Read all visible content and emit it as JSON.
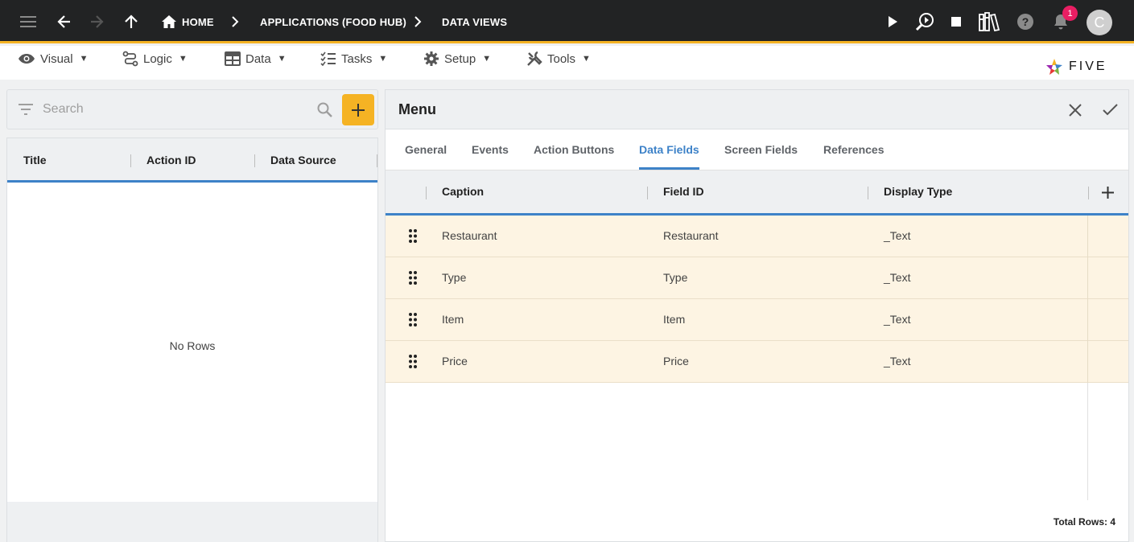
{
  "topbar": {
    "breadcrumbs": [
      "HOME",
      "APPLICATIONS (FOOD HUB)",
      "DATA VIEWS"
    ],
    "notification_count": "1",
    "avatar_initial": "C",
    "accent_color": "#f5b324"
  },
  "menubar": {
    "items": [
      "Visual",
      "Logic",
      "Data",
      "Tasks",
      "Setup",
      "Tools"
    ],
    "logo_text": "FIVE"
  },
  "left": {
    "search_placeholder": "Search",
    "columns": [
      "Title",
      "Action ID",
      "Data Source"
    ],
    "empty_text": "No Rows"
  },
  "right": {
    "title": "Menu",
    "tabs": [
      "General",
      "Events",
      "Action Buttons",
      "Data Fields",
      "Screen Fields",
      "References"
    ],
    "active_tab": "Data Fields",
    "columns": [
      "Caption",
      "Field ID",
      "Display Type"
    ],
    "rows": [
      {
        "caption": "Restaurant",
        "field_id": "Restaurant",
        "display_type": "_Text"
      },
      {
        "caption": "Type",
        "field_id": "Type",
        "display_type": "_Text"
      },
      {
        "caption": "Item",
        "field_id": "Item",
        "display_type": "_Text"
      },
      {
        "caption": "Price",
        "field_id": "Price",
        "display_type": "_Text"
      }
    ],
    "total_rows": "Total Rows: 4"
  }
}
